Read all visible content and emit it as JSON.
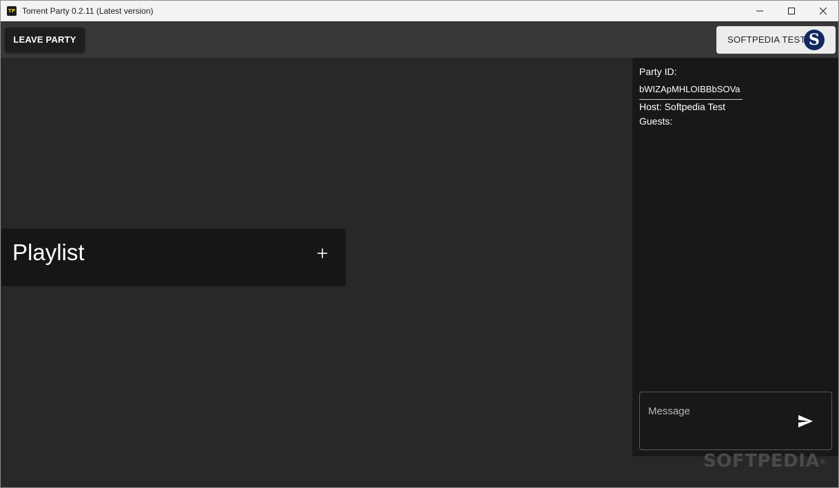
{
  "window": {
    "title": "Torrent Party 0.2.11 (Latest version)",
    "icon_text": "TP"
  },
  "appbar": {
    "leave_label": "LEAVE PARTY",
    "user_label": "SOFTPEDIA TEST",
    "avatar_letter": "S"
  },
  "playlist": {
    "title": "Playlist",
    "add_icon": "plus-icon"
  },
  "party": {
    "id_label": "Party ID:",
    "id_value": "bWIZApMHLOIBBbSOVa",
    "host_line": "Host: Softpedia Test",
    "guests_line": "Guests:"
  },
  "chat": {
    "placeholder": "Message",
    "send_icon": "send-icon"
  },
  "watermark": "SOFTPEDIA",
  "colors": {
    "background": "#282828",
    "appbar": "#383838",
    "panel": "#181818",
    "card": "#161616"
  }
}
